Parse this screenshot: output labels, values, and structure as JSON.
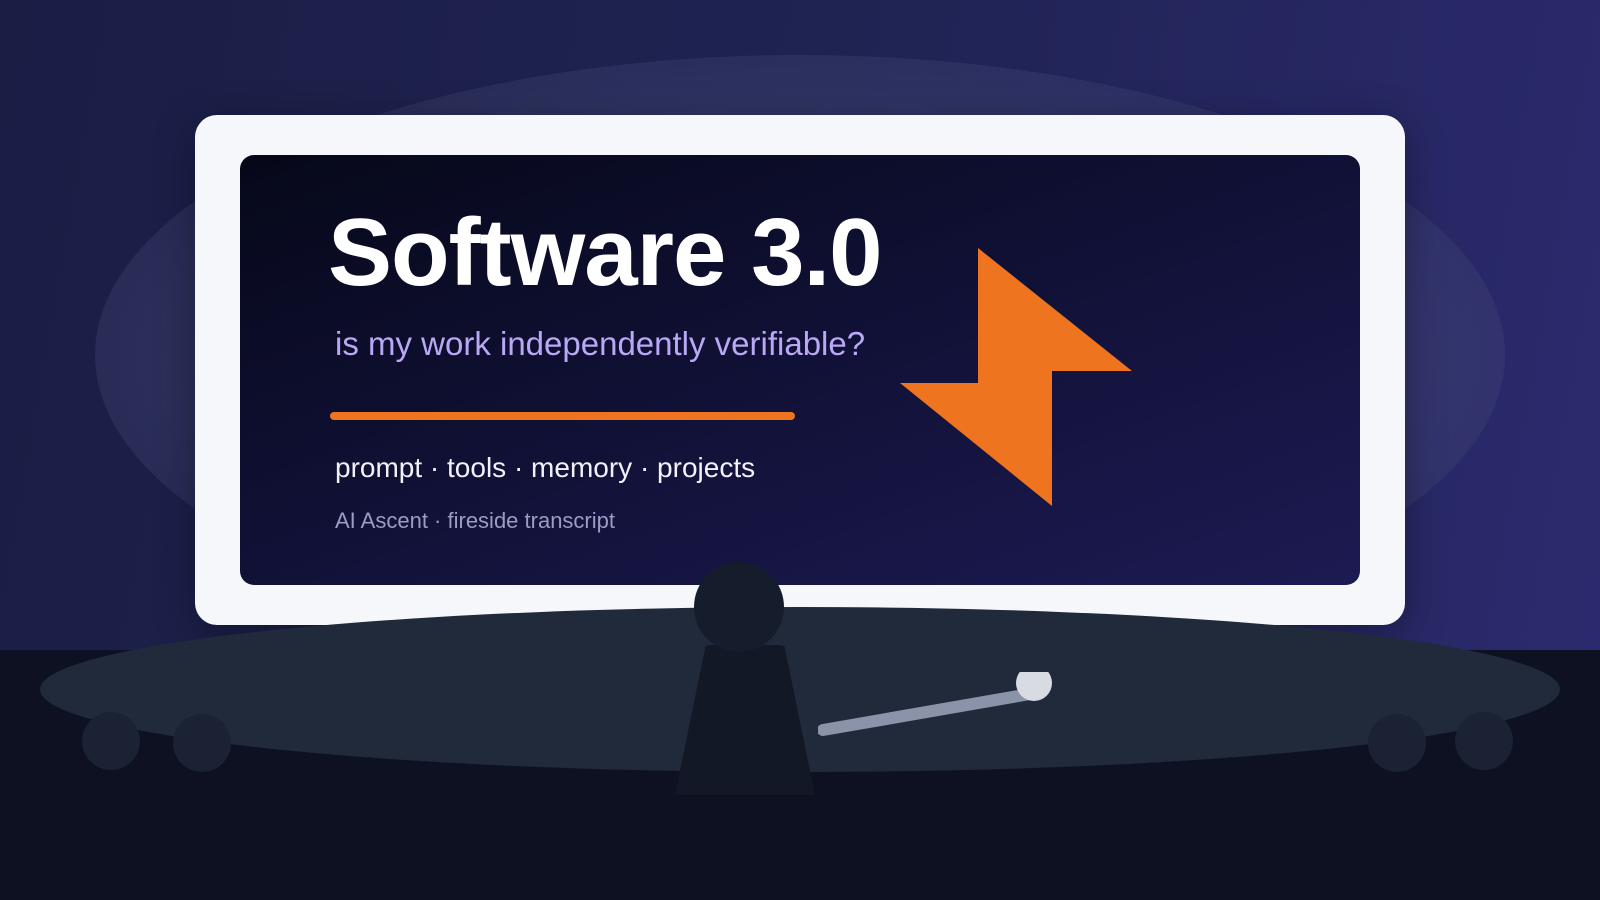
{
  "slide": {
    "title": "Software 3.0",
    "subtitle": "is my work independently verifiable?",
    "topics": "prompt · tools · memory · projects",
    "caption": "AI Ascent · fireside transcript"
  },
  "icons": {
    "slide_logo": "lightning-bolt-icon",
    "presenter_tool": "laser-pointer-icon"
  },
  "colors": {
    "accent": "#ef7420",
    "subtitle": "#b9a8f5",
    "frame": "#f5f7fb",
    "slide_bg": "#0d0e2c"
  }
}
